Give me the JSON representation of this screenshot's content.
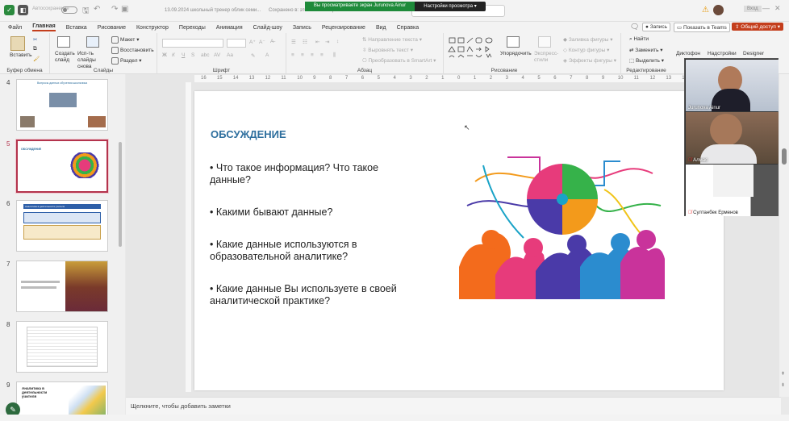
{
  "titlebar": {
    "autosave_label": "Автосохранение",
    "doc_title": "13.09.2024 школьный тренер облик семи...",
    "save_status": "Сохранено в: этот компьютер",
    "share_banner_left": "Вы просматриваете экран Jurunova Ainur",
    "share_banner_right": "Настройки просмотра",
    "hide_label": "Вход"
  },
  "menu": [
    "Файл",
    "Главная",
    "Вставка",
    "Рисование",
    "Конструктор",
    "Переходы",
    "Анимация",
    "Слайд-шоу",
    "Запись",
    "Рецензирование",
    "Вид",
    "Справка"
  ],
  "menu_right": {
    "record": "Запись",
    "present_teams": "Показать в Teams",
    "share": "Общий доступ"
  },
  "ribbon": {
    "paste": "Вставить",
    "clipboard": "Буфер обмена",
    "new_slide": "Создать слайд",
    "reuse_slides": "Исп-ть слайды снова",
    "slides": "Слайды",
    "layout": "Макет",
    "reset": "Восстановить",
    "section": "Раздел",
    "font": "Шрифт",
    "paragraph": "Абзац",
    "text_direction": "Направление текста",
    "align_text": "Выровнять текст",
    "smartart": "Преобразовать в SmartArt",
    "arrange": "Упорядочить",
    "quick_styles": "Экспресс-стили",
    "drawing": "Рисование",
    "shape_fill": "Заливка фигуры",
    "shape_outline": "Контур фигуры",
    "shape_effects": "Эффекты фигуры",
    "find": "Найти",
    "replace": "Заменить",
    "select": "Выделить",
    "editing": "Редактирование",
    "dictate": "Диктофон",
    "addins": "Надстройки",
    "designer": "Designer"
  },
  "thumbs": [
    {
      "num": "4",
      "title": "Вопросы данных обучения школьника"
    },
    {
      "num": "5",
      "title": "ОБСУЖДЕНИЕ"
    },
    {
      "num": "6",
      "title": "Аналитика в деятельности учителя"
    },
    {
      "num": "7",
      "title": ""
    },
    {
      "num": "8",
      "title": ""
    },
    {
      "num": "9",
      "title": "Аналитика в деятельности учителя"
    }
  ],
  "ruler": [
    "16",
    "15",
    "14",
    "13",
    "12",
    "11",
    "10",
    "9",
    "8",
    "7",
    "6",
    "5",
    "4",
    "3",
    "2",
    "1",
    "0",
    "1",
    "2",
    "3",
    "4",
    "5",
    "6",
    "7",
    "8",
    "9",
    "10",
    "11",
    "12",
    "13",
    "14",
    "15",
    "16"
  ],
  "slide": {
    "title": "ОБСУЖДЕНИЕ",
    "bullets": [
      "Что такое информация? Что такое данные?",
      "Какими бывают данные?",
      "Какие данные используются в образовательной аналитике?",
      "Какие данные Вы используете в своей аналитической практике?"
    ]
  },
  "notes_placeholder": "Щелкните, чтобы добавить заметки",
  "participants": [
    "Jurunova Ainur",
    "Алмас",
    "Султанбек Ерменов"
  ],
  "colors": {
    "accent": "#c43e1c",
    "title_blue": "#2e6f9e",
    "banner_green": "#1e8a3a",
    "selected_thumb": "#b4344d"
  }
}
